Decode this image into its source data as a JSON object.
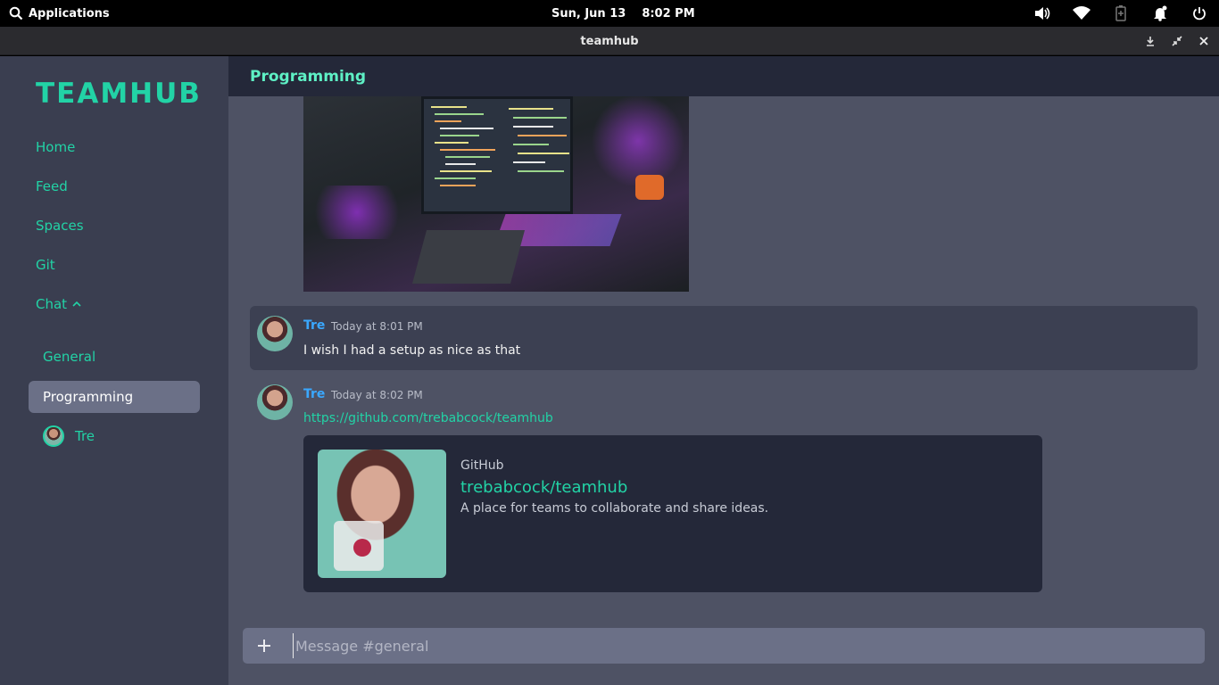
{
  "system_bar": {
    "applications_label": "Applications",
    "date": "Sun, Jun 13",
    "time": "8:02 PM"
  },
  "window": {
    "title": "teamhub"
  },
  "sidebar": {
    "brand": "TEAMHUB",
    "nav": [
      {
        "label": "Home"
      },
      {
        "label": "Feed"
      },
      {
        "label": "Spaces"
      },
      {
        "label": "Git"
      },
      {
        "label": "Chat"
      }
    ],
    "channels": [
      {
        "label": "General",
        "active": false
      },
      {
        "label": "Programming",
        "active": true
      }
    ],
    "members": [
      {
        "name": "Tre"
      }
    ]
  },
  "main": {
    "channel_name": "Programming",
    "messages": [
      {
        "author": "Tre",
        "time": "Today at 8:01 PM",
        "text": "I wish I had a setup as nice as that"
      },
      {
        "author": "Tre",
        "time": "Today at 8:02 PM",
        "link": "https://github.com/trebabcock/teamhub"
      }
    ],
    "embed": {
      "provider": "GitHub",
      "title": "trebabcock/teamhub",
      "description": "A place for teams to collaborate and share ideas."
    },
    "composer": {
      "placeholder": "Message #general"
    }
  },
  "colors": {
    "accent": "#22d3a6",
    "author": "#3aa8ff",
    "sidebar_bg": "#3a3e50",
    "main_bg": "#4e5264",
    "header_bg": "#242839"
  }
}
